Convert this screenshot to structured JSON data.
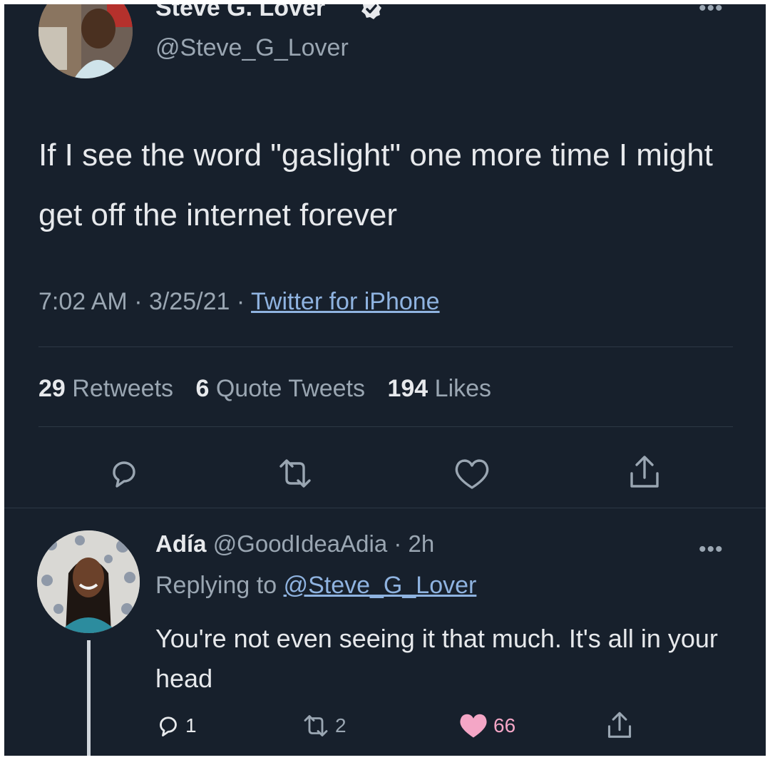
{
  "colors": {
    "background": "#17202c",
    "text_primary": "#e7e9ec",
    "text_secondary": "#9aa6b2",
    "link": "#8fb3e0",
    "like_active": "#f4a6c6",
    "divider": "#2d3845"
  },
  "tweet": {
    "author_name": "Steve G. Lover",
    "author_handle": "@Steve_G_Lover",
    "verified": true,
    "text": "If I see the word \"gaslight\" one more time I might get off the internet forever",
    "time": "7:02 AM",
    "date": "3/25/21",
    "source": "Twitter for iPhone",
    "more_icon": "•••",
    "stats": {
      "retweets_count": "29",
      "retweets_label": "Retweets",
      "quotes_count": "6",
      "quotes_label": "Quote Tweets",
      "likes_count": "194",
      "likes_label": "Likes"
    },
    "actions": [
      "reply-icon",
      "retweet-icon",
      "like-icon",
      "share-icon"
    ]
  },
  "reply": {
    "author_name": "Adía",
    "author_handle": "@GoodIdeaAdia",
    "age": "2h",
    "replying_prefix": "Replying to",
    "replying_to": "@Steve_G_Lover",
    "text": "You're not even seeing it that much. It's all in your head",
    "more_icon": "•••",
    "reply_count": "1",
    "retweet_count": "2",
    "like_count": "66",
    "liked": true
  }
}
